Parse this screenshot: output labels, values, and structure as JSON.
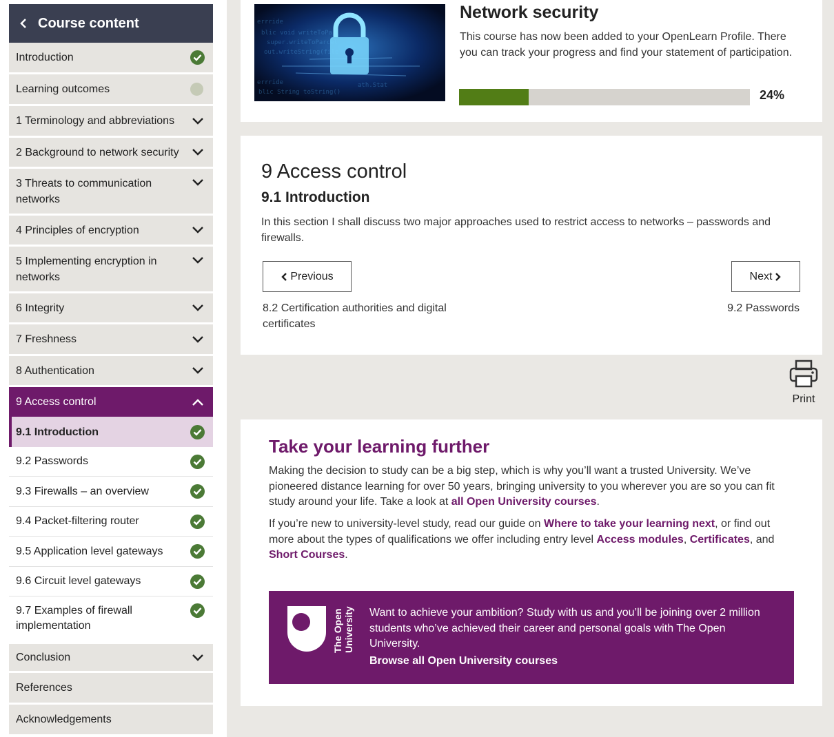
{
  "sidebar": {
    "title": "Course content",
    "items": [
      {
        "label": "Introduction",
        "state": "complete"
      },
      {
        "label": "Learning outcomes",
        "state": "incomplete"
      },
      {
        "label": "1 Terminology and abbreviations",
        "state": "collapsed"
      },
      {
        "label": "2 Background to network security",
        "state": "collapsed"
      },
      {
        "label": "3 Threats to communication networks",
        "state": "collapsed"
      },
      {
        "label": "4 Principles of encryption",
        "state": "collapsed"
      },
      {
        "label": "5 Implementing encryption in networks",
        "state": "collapsed"
      },
      {
        "label": "6 Integrity",
        "state": "collapsed"
      },
      {
        "label": "7 Freshness",
        "state": "collapsed"
      },
      {
        "label": "8 Authentication",
        "state": "collapsed"
      },
      {
        "label": "9 Access control",
        "state": "expanded"
      }
    ],
    "subitems": [
      {
        "label": "9.1 Introduction",
        "state": "complete",
        "current": true
      },
      {
        "label": "9.2 Passwords",
        "state": "complete"
      },
      {
        "label": "9.3 Firewalls – an overview",
        "state": "complete"
      },
      {
        "label": "9.4 Packet-filtering router",
        "state": "complete"
      },
      {
        "label": "9.5 Application level gateways",
        "state": "complete"
      },
      {
        "label": "9.6 Circuit level gateways",
        "state": "complete"
      },
      {
        "label": "9.7 Examples of firewall implementation",
        "state": "complete"
      }
    ],
    "tail_items": [
      {
        "label": "Conclusion",
        "state": "collapsed"
      },
      {
        "label": "References",
        "state": "none"
      },
      {
        "label": "Acknowledgements",
        "state": "none"
      }
    ]
  },
  "course": {
    "title": "Network security",
    "description": "This course has now been added to your OpenLearn Profile. There you can track your progress and find your statement of participation.",
    "progress_percent": 24,
    "progress_label": "24%"
  },
  "section": {
    "heading": "9 Access control",
    "subheading": "9.1 Introduction",
    "body": "In this section I shall discuss two major approaches used to restrict access to networks – passwords and firewalls.",
    "prev_label": "Previous",
    "prev_caption": "8.2 Certification authorities and digital certificates",
    "next_label": "Next",
    "next_caption": "9.2 Passwords"
  },
  "print": {
    "label": "Print"
  },
  "further": {
    "heading": "Take your learning further",
    "p1_text": "Making the decision to study can be a big step, which is why you’ll want a trusted University. We’ve pioneered distance learning for over 50 years, bringing university to you wherever you are so you can fit study around your life. Take a look at ",
    "p1_link": "all Open University courses",
    "p1_end": ".",
    "p2_a": "If you’re new to university-level study, read our guide on ",
    "p2_link1": "Where to take your learning next",
    "p2_b": ", or find out more about the types of qualifications we offer including entry level ",
    "p2_link2": "Access modules",
    "p2_c": ", ",
    "p2_link3": "Certificates",
    "p2_d": ", and ",
    "p2_link4": "Short Courses",
    "p2_e": ".",
    "banner_logo_text": "The Open University",
    "banner_text": "Want to achieve your ambition? Study with us and you’ll be joining over 2 million students who’ve achieved their career and personal goals with The Open University.",
    "banner_link": "Browse all Open University courses"
  },
  "colors": {
    "brand_purple": "#6e1a6a",
    "progress_green": "#527d16",
    "check_green": "#4b7a36",
    "sidebar_header": "#3a3f51"
  }
}
